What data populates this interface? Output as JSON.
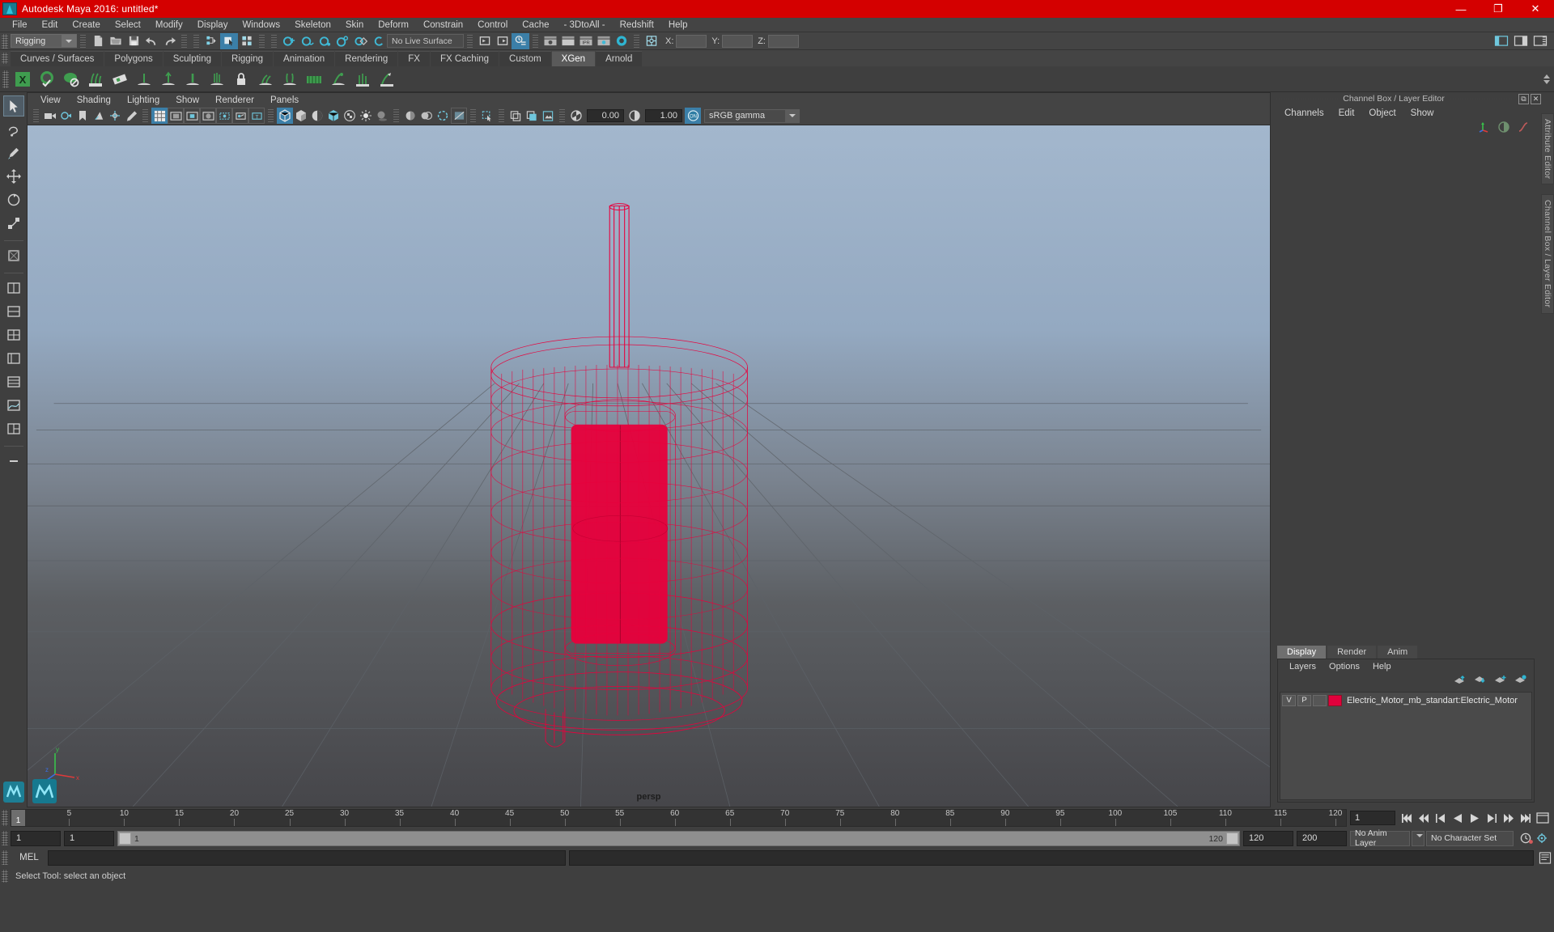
{
  "window": {
    "title": "Autodesk Maya 2016: untitled*",
    "minimize": "—",
    "maximize": "❐",
    "close": "✕",
    "titlebar_color": "#d40000"
  },
  "menubar": {
    "items": [
      "File",
      "Edit",
      "Create",
      "Select",
      "Modify",
      "Display",
      "Windows",
      "Skeleton",
      "Skin",
      "Deform",
      "Constrain",
      "Control",
      "Cache",
      "- 3DtoAll -",
      "Redshift",
      "Help"
    ]
  },
  "statusline": {
    "mode_selector": "Rigging",
    "live_surface": "No Live Surface",
    "coord_x_label": "X:",
    "coord_y_label": "Y:",
    "coord_z_label": "Z:",
    "coord_x_value": "",
    "coord_y_value": "",
    "coord_z_value": ""
  },
  "shelf": {
    "tabs": [
      "Curves / Surfaces",
      "Polygons",
      "Sculpting",
      "Rigging",
      "Animation",
      "Rendering",
      "FX",
      "FX Caching",
      "Custom",
      "XGen",
      "Arnold"
    ],
    "active_tab": "XGen"
  },
  "viewport": {
    "menu": [
      "View",
      "Shading",
      "Lighting",
      "Show",
      "Renderer",
      "Panels"
    ],
    "exposure_value": "0.00",
    "gamma_value": "1.00",
    "color_management": "sRGB gamma",
    "camera_label": "persp",
    "axis_x": "x",
    "axis_y": "y",
    "axis_z": "z",
    "model_color": "#e8003c",
    "sky_top": "#9fb3c9",
    "ground": "#4a4a4c"
  },
  "right_dock": {
    "panel_title": "Channel Box / Layer Editor",
    "channel_menu": [
      "Channels",
      "Edit",
      "Object",
      "Show"
    ],
    "vertical_tabs": [
      "Attribute Editor",
      "Channel Box / Layer Editor"
    ],
    "layer_tabs": [
      "Display",
      "Render",
      "Anim"
    ],
    "layer_tabs_active": "Display",
    "layer_menu": [
      "Layers",
      "Options",
      "Help"
    ],
    "layers": [
      {
        "visibility": "V",
        "playback": "P",
        "shading": "",
        "color": "#e0003c",
        "name": "Electric_Motor_mb_standart:Electric_Motor"
      }
    ]
  },
  "timeline": {
    "current_frame": "1",
    "ticks": [
      5,
      10,
      15,
      20,
      25,
      30,
      35,
      40,
      45,
      50,
      55,
      60,
      65,
      70,
      75,
      80,
      85,
      90,
      95,
      100,
      105,
      110,
      115,
      120
    ],
    "range_start": 1,
    "range_end": 120,
    "frame_field": "1"
  },
  "range_slider": {
    "anim_start": "1",
    "range_start": "1",
    "slider_start_label": "1",
    "slider_end_label": "120",
    "range_end": "120",
    "anim_end": "200",
    "anim_layer": "No Anim Layer",
    "character_set": "No Character Set"
  },
  "command_line": {
    "language": "MEL",
    "input_value": "",
    "output_value": ""
  },
  "help_line": {
    "text": "Select Tool: select an object"
  }
}
